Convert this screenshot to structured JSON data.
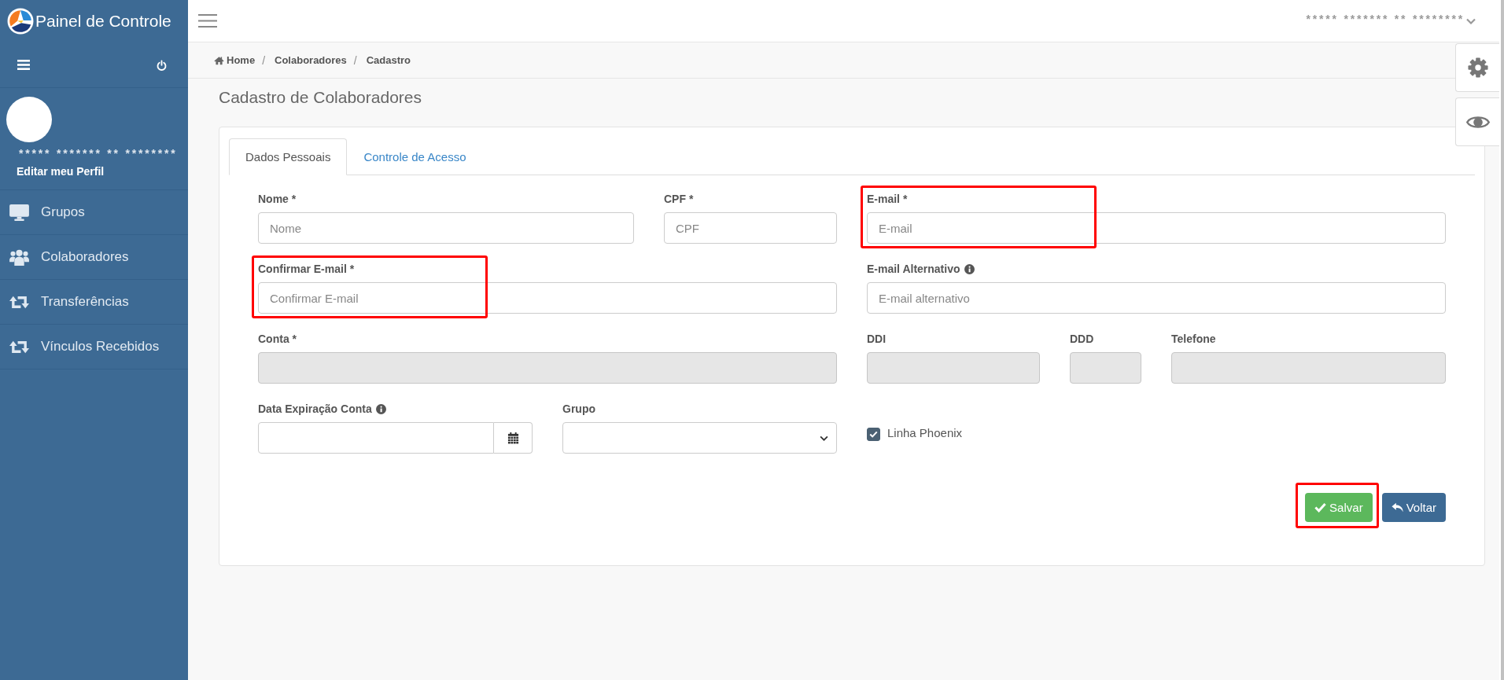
{
  "sidebar": {
    "brand": "Painel de Controle",
    "profile": {
      "name": "***** ******* ** ********",
      "link": "Editar meu Perfil"
    },
    "items": [
      {
        "label": "Grupos"
      },
      {
        "label": "Colaboradores"
      },
      {
        "label": "Transferências"
      },
      {
        "label": "Vínculos Recebidos"
      }
    ]
  },
  "top_bar": {
    "user_name": "***** ******* ** ********"
  },
  "breadcrumb": {
    "separator": "/",
    "items": [
      "Home",
      "Colaboradores",
      "Cadastro"
    ]
  },
  "page_title": "Cadastro de Colaboradores",
  "tabs": [
    {
      "label": "Dados Pessoais",
      "selected": true
    },
    {
      "label": "Controle de Acesso",
      "selected": false
    }
  ],
  "form": {
    "fields": [
      {
        "kind": "text",
        "label": "Nome *",
        "info": false,
        "placeholder": "Nome",
        "disabled": false,
        "highlighted": false
      },
      {
        "kind": "text",
        "label": "CPF *",
        "info": false,
        "placeholder": "CPF",
        "disabled": false,
        "highlighted": false
      },
      {
        "kind": "text",
        "label": "E-mail *",
        "info": false,
        "placeholder": "E-mail",
        "disabled": false,
        "highlighted": true
      },
      {
        "kind": "text",
        "label": "Confirmar E-mail *",
        "info": false,
        "placeholder": "Confirmar E-mail",
        "disabled": false,
        "highlighted": true
      },
      {
        "kind": "text",
        "label": "E-mail Alternativo",
        "info": true,
        "placeholder": "E-mail alternativo",
        "disabled": false,
        "highlighted": false
      },
      {
        "kind": "text",
        "label": "Conta *",
        "info": false,
        "disabled": true,
        "highlighted": false
      },
      {
        "kind": "text",
        "label": "DDI",
        "info": false,
        "disabled": true,
        "highlighted": false
      },
      {
        "kind": "text",
        "label": "DDD",
        "info": false,
        "disabled": true,
        "highlighted": false
      },
      {
        "kind": "text",
        "label": "Telefone",
        "info": false,
        "disabled": true,
        "highlighted": false
      },
      {
        "kind": "date",
        "label": "Data Expiração Conta",
        "info": true,
        "disabled": false,
        "highlighted": false
      },
      {
        "kind": "select",
        "label": "Grupo",
        "info": false,
        "disabled": false,
        "highlighted": false
      },
      {
        "kind": "checkbox",
        "label": "Linha Phoenix",
        "info": false,
        "checked": true,
        "disabled": false,
        "highlighted": false
      }
    ],
    "buttons": [
      {
        "kind": "save",
        "label": "Salvar",
        "highlighted": true
      },
      {
        "kind": "back",
        "label": "Voltar",
        "highlighted": false
      }
    ]
  }
}
